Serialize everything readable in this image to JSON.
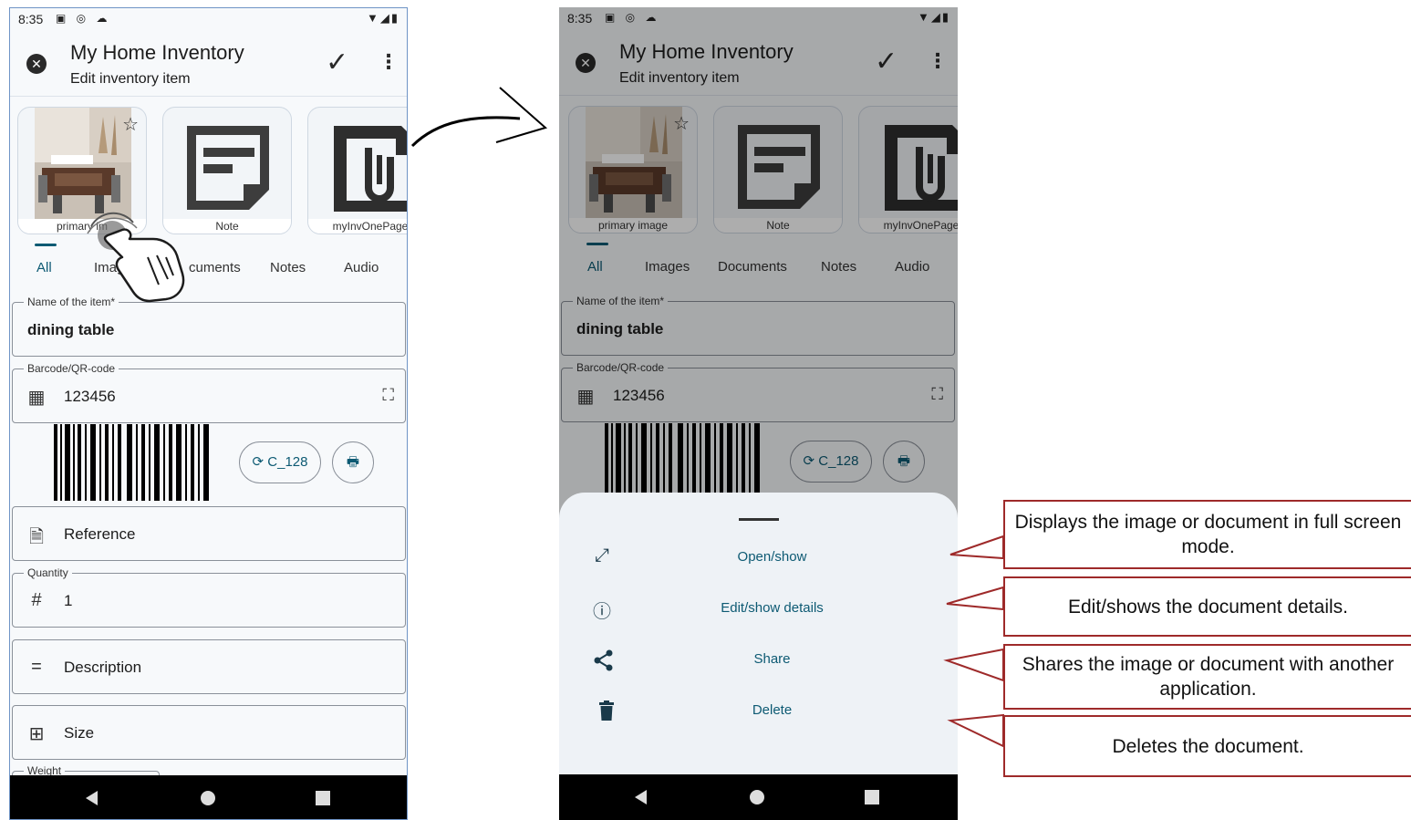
{
  "status": {
    "time": "8:35"
  },
  "app": {
    "title": "My Home Inventory",
    "subtitle": "Edit inventory item"
  },
  "attachments": [
    {
      "caption": "primary image",
      "caption_clipped": "primary im"
    },
    {
      "caption": "Note"
    },
    {
      "caption": "myInvOnePager"
    }
  ],
  "tabs": [
    "All",
    "Images",
    "Documents",
    "Notes",
    "Audio"
  ],
  "tabs_clipped": {
    "images": "Imag",
    "documents": "cuments"
  },
  "fields": {
    "name": {
      "label": "Name of the item*",
      "value": "dining table"
    },
    "barcode": {
      "label": "Barcode/QR-code",
      "value": "123456",
      "format_button": "C_128"
    },
    "reference": {
      "placeholder": "Reference"
    },
    "quantity": {
      "label": "Quantity",
      "value": "1"
    },
    "description": {
      "placeholder": "Description"
    },
    "size": {
      "placeholder": "Size"
    },
    "weight": {
      "label": "Weight"
    }
  },
  "sheet": {
    "items": [
      {
        "label": "Open/show",
        "icon": "fullscreen-icon"
      },
      {
        "label": "Edit/show details",
        "icon": "info-icon"
      },
      {
        "label": "Share",
        "icon": "share-icon"
      },
      {
        "label": "Delete",
        "icon": "trash-icon"
      }
    ]
  },
  "callouts": [
    "Displays the image or document in full screen mode.",
    "Edit/shows the document details.",
    "Shares the image or document with another application.",
    "Deletes the document."
  ],
  "colors": {
    "accent": "#0d5a73",
    "callout_border": "#9e2a2a",
    "phone_border": "#6f94c6"
  }
}
